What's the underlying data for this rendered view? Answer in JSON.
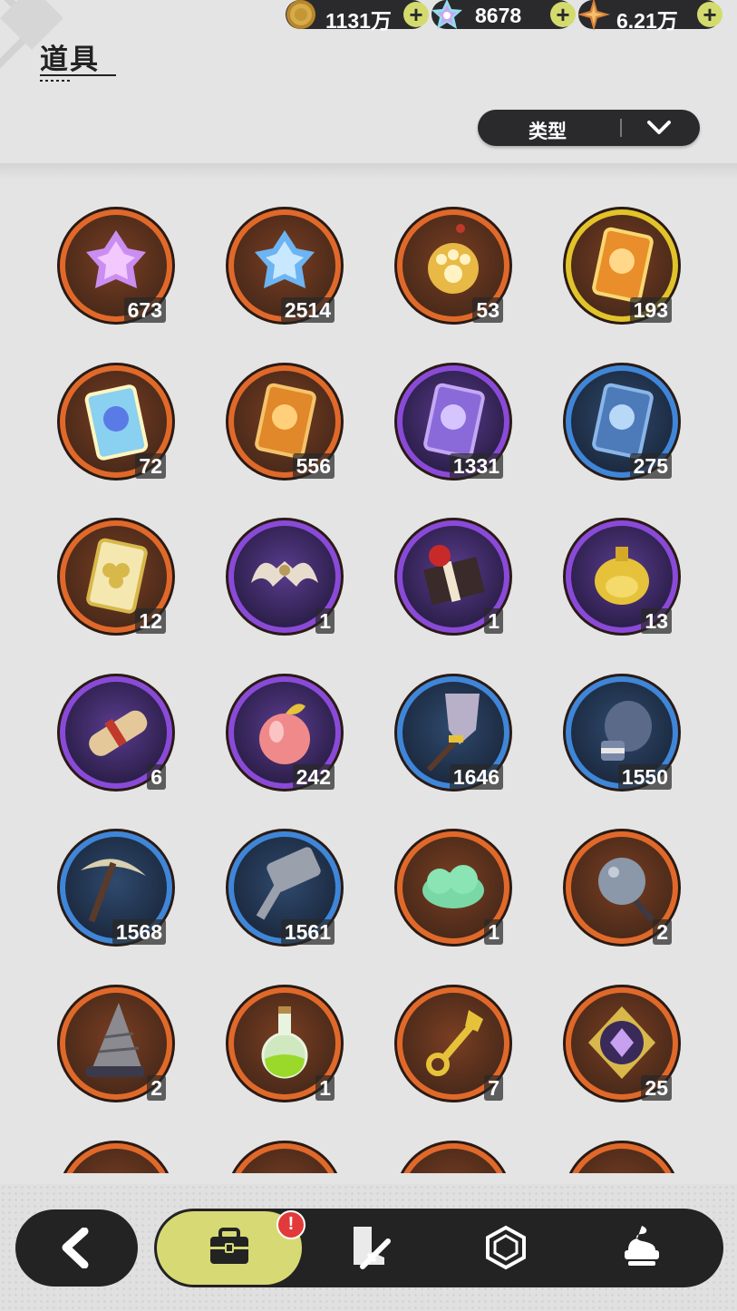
{
  "header": {
    "title": "道具"
  },
  "currencies": [
    {
      "name": "coin",
      "icon": "gold-coin-icon",
      "value": "1131万",
      "color": "#c9a030"
    },
    {
      "name": "crystal",
      "icon": "crystal-icon",
      "value": "8678",
      "color": "#7ed3e6"
    },
    {
      "name": "star-shard",
      "icon": "star-shard-icon",
      "value": "6.21万",
      "color": "#d8813a"
    }
  ],
  "filter": {
    "label": "类型"
  },
  "rarity_colors": {
    "orange": "#e0692a",
    "gold": "#e2c32a",
    "purple": "#8a4ad8",
    "blue": "#3f86d8"
  },
  "items": [
    {
      "icon": "purple-crystal-icon",
      "rarity": "orange",
      "count": "673"
    },
    {
      "icon": "blue-crystal-icon",
      "rarity": "orange",
      "count": "2514"
    },
    {
      "icon": "paw-medal-icon",
      "rarity": "orange",
      "count": "53"
    },
    {
      "icon": "gold-card-icon",
      "rarity": "gold",
      "count": "193"
    },
    {
      "icon": "rainbow-card-icon",
      "rarity": "orange",
      "count": "72"
    },
    {
      "icon": "orange-card-icon",
      "rarity": "orange",
      "count": "556"
    },
    {
      "icon": "purple-card-icon",
      "rarity": "purple",
      "count": "1331"
    },
    {
      "icon": "blue-card-icon",
      "rarity": "blue",
      "count": "275"
    },
    {
      "icon": "clover-ticket-icon",
      "rarity": "orange",
      "count": "12"
    },
    {
      "icon": "horn-ornament-icon",
      "rarity": "purple",
      "count": "1"
    },
    {
      "icon": "gift-box-icon",
      "rarity": "purple",
      "count": "1"
    },
    {
      "icon": "golden-bell-icon",
      "rarity": "purple",
      "count": "13"
    },
    {
      "icon": "scroll-icon",
      "rarity": "purple",
      "count": "6"
    },
    {
      "icon": "apple-icon",
      "rarity": "purple",
      "count": "242"
    },
    {
      "icon": "shovel-icon",
      "rarity": "blue",
      "count": "1646"
    },
    {
      "icon": "boxing-glove-icon",
      "rarity": "blue",
      "count": "1550"
    },
    {
      "icon": "pickaxe-icon",
      "rarity": "blue",
      "count": "1568"
    },
    {
      "icon": "hammer-icon",
      "rarity": "blue",
      "count": "1561"
    },
    {
      "icon": "cloud-icon",
      "rarity": "orange",
      "count": "1"
    },
    {
      "icon": "spiked-ball-icon",
      "rarity": "orange",
      "count": "2"
    },
    {
      "icon": "drill-icon",
      "rarity": "orange",
      "count": "2"
    },
    {
      "icon": "potion-icon",
      "rarity": "orange",
      "count": "1"
    },
    {
      "icon": "golden-key-icon",
      "rarity": "orange",
      "count": "7"
    },
    {
      "icon": "emblem-icon",
      "rarity": "orange",
      "count": "25"
    },
    {
      "icon": "partial-item-icon",
      "rarity": "orange",
      "count": ""
    },
    {
      "icon": "partial-item-icon",
      "rarity": "orange",
      "count": ""
    },
    {
      "icon": "partial-item-icon",
      "rarity": "orange",
      "count": ""
    },
    {
      "icon": "partial-item-icon",
      "rarity": "orange",
      "count": ""
    }
  ],
  "bottom_nav": {
    "back_icon": "back-arrow-icon",
    "badge": "!",
    "tabs": [
      {
        "name": "bag",
        "icon": "bag-icon",
        "active": true
      },
      {
        "name": "equipment",
        "icon": "sword-boot-icon",
        "active": false
      },
      {
        "name": "gems",
        "icon": "hexagon-gem-icon",
        "active": false
      },
      {
        "name": "food",
        "icon": "dessert-icon",
        "active": false
      }
    ]
  }
}
